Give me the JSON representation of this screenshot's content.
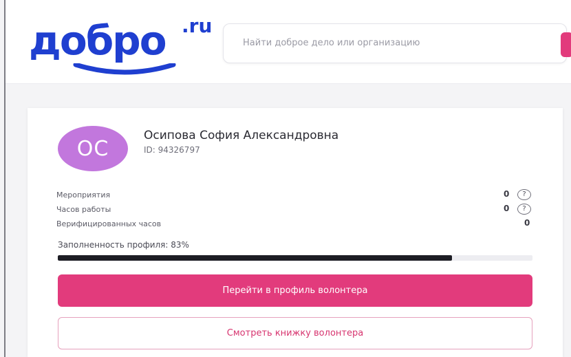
{
  "header": {
    "logo_word": "добро",
    "logo_suffix": ".ru",
    "search_placeholder": "Найти доброе дело или организацию"
  },
  "profile": {
    "avatar_initials": "ОС",
    "name": "Осипова София Александровна",
    "id_text": "ID: 94326797",
    "stats": [
      {
        "label": "Мероприятия",
        "value": "0",
        "help": "?"
      },
      {
        "label": "Часов работы",
        "value": "0",
        "help": "?"
      },
      {
        "label": "Верифицированных часов",
        "value": "0"
      }
    ],
    "completion_label": "Заполненность профиля: 83%",
    "completion_fraction": 0.83,
    "primary_button": "Перейти в профиль волонтера",
    "secondary_button": "Смотреть книжку волонтера"
  },
  "colors": {
    "brand_blue": "#1f3fd0",
    "accent_pink": "#e23b7c",
    "avatar_purple": "#c277dd"
  }
}
